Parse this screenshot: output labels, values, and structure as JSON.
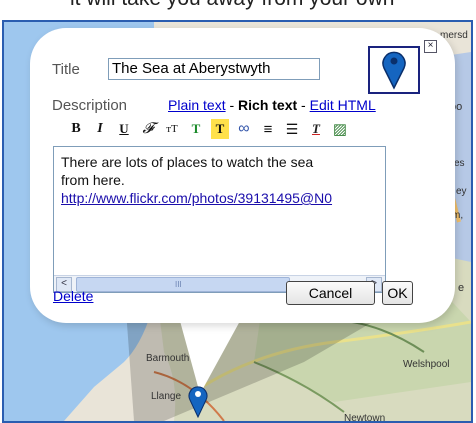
{
  "caption": "it will take you away from your own",
  "map": {
    "places": [
      "Barmouth",
      "Llange",
      "Welshpool",
      "Newtown",
      "mersd",
      "oo",
      "es",
      "ey",
      "m,",
      "e"
    ]
  },
  "popup": {
    "close_glyph": "×",
    "title_label": "Title",
    "title_value": "The Sea at Aberystwyth",
    "description_label": "Description",
    "mode_plain": "Plain text",
    "mode_sep1": " - ",
    "mode_rich": "Rich text",
    "mode_sep2": " - ",
    "mode_html": "Edit HTML",
    "toolbar": [
      {
        "name": "bold-icon",
        "glyph": "B"
      },
      {
        "name": "italic-icon",
        "glyph": "I"
      },
      {
        "name": "underline-icon",
        "glyph": "U"
      },
      {
        "name": "font-family-icon",
        "glyph": "𝓕"
      },
      {
        "name": "font-size-icon",
        "glyph": "тТ"
      },
      {
        "name": "text-color-icon",
        "glyph": "T"
      },
      {
        "name": "highlight-icon",
        "glyph": "T"
      },
      {
        "name": "link-icon",
        "glyph": "∞"
      },
      {
        "name": "numbered-list-icon",
        "glyph": "≡"
      },
      {
        "name": "bullet-list-icon",
        "glyph": "☰"
      },
      {
        "name": "remove-format-icon",
        "glyph": "T"
      },
      {
        "name": "image-icon",
        "glyph": "▨"
      }
    ],
    "body_line1": "There are lots of places to watch the sea",
    "body_line2": "from here.",
    "body_url": "http://www.flickr.com/photos/39131495@N0",
    "scroll_left": "<",
    "scroll_right": ">",
    "scroll_grip": "III",
    "delete_label": "Delete",
    "cancel_label": "Cancel",
    "ok_label": "OK"
  },
  "colors": {
    "link": "#0000cc",
    "border": "#2a5db0",
    "marker": "#1565c0"
  }
}
